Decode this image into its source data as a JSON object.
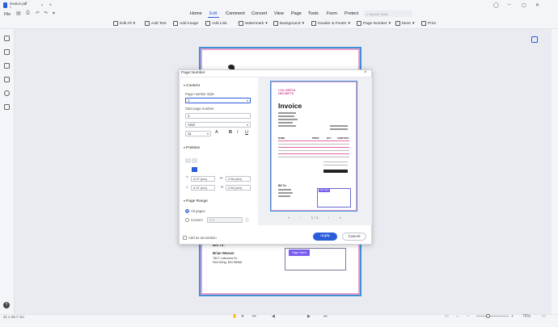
{
  "window": {
    "tab_title": "invoice.pdf *",
    "file_label": "File",
    "search_placeholder": "Search Tools"
  },
  "menu": [
    "Home",
    "Edit",
    "Comment",
    "Convert",
    "View",
    "Page",
    "Tools",
    "Form",
    "Protect"
  ],
  "active_menu": "Edit",
  "toolbar": {
    "edit_all": "Edit All",
    "add_text": "Add Text",
    "add_image": "Add Image",
    "add_link": "Add Link",
    "watermark": "Watermark",
    "background": "Background",
    "header_footer": "Header & Footer",
    "page_number": "Page Number",
    "more": "More",
    "print": "Print"
  },
  "document": {
    "bill_to": "Bill To:",
    "customer_name": "Brian Weaver",
    "address_line1": "7827 Lakeview Dr",
    "address_line2": "Red Wing, MN 55066",
    "sign_here": "Sign Here"
  },
  "dialog": {
    "title": "Page Number",
    "content_section": "Content",
    "page_number_style_label": "Page number style",
    "page_number_style_value": "1",
    "start_page_label": "Start page number",
    "start_page_value": "1",
    "font_value": "Arial",
    "font_size_value": "11",
    "position_section": "Position",
    "pos_top": "0.27 (cm)",
    "pos_right": "2.54 (cm)",
    "pos_bottom": "0.27 (cm)",
    "pos_left": "2.54 (cm)",
    "page_range_section": "Page Range",
    "all_pages": "All pages",
    "custom": "Custom",
    "custom_value": "1-4",
    "apply_to_annotation": "Add as annotation",
    "apply": "Apply",
    "cancel": "Cancel",
    "page_indicator": "1 / 1"
  },
  "preview": {
    "brand_line1": "COLORFUL",
    "brand_line2": "HELMETS",
    "invoice_title": "Invoice",
    "col_name": "NAME",
    "col_price": "PRICE",
    "col_qty": "QTY",
    "col_subtotal": "SUBTOTAL",
    "bill_to": "Bill To:",
    "sign_here": "Sign Here"
  },
  "status": {
    "page_size": "21 x 29.7 cm",
    "zoom": "75%"
  },
  "colors": {
    "accent": "#2b5cd9",
    "sign_button": "#7a5cf0",
    "page_border_pink": "#e7a0c9",
    "page_border_blue": "#3f8fd9"
  }
}
